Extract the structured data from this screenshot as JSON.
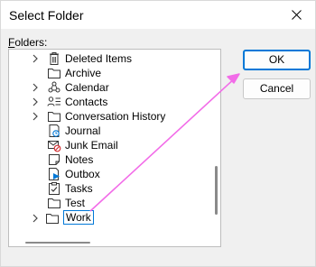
{
  "dialog": {
    "title": "Select Folder",
    "folders_label_accel": "F",
    "folders_label_rest": "olders:"
  },
  "tree": {
    "items": [
      {
        "label": "Deleted Items",
        "icon": "trash-icon",
        "has_chevron": true
      },
      {
        "label": "Archive",
        "icon": "folder-icon",
        "has_chevron": false
      },
      {
        "label": "Calendar",
        "icon": "calendar-icon",
        "has_chevron": true
      },
      {
        "label": "Contacts",
        "icon": "contacts-icon",
        "has_chevron": true
      },
      {
        "label": "Conversation History",
        "icon": "folder-icon",
        "has_chevron": true
      },
      {
        "label": "Journal",
        "icon": "journal-icon",
        "has_chevron": false
      },
      {
        "label": "Junk Email",
        "icon": "junk-email-icon",
        "has_chevron": false
      },
      {
        "label": "Notes",
        "icon": "notes-icon",
        "has_chevron": false
      },
      {
        "label": "Outbox",
        "icon": "outbox-icon",
        "has_chevron": false
      },
      {
        "label": "Tasks",
        "icon": "tasks-icon",
        "has_chevron": false
      },
      {
        "label": "Test",
        "icon": "folder-icon",
        "has_chevron": false
      },
      {
        "label": "Work",
        "icon": "folder-icon",
        "has_chevron": true,
        "selected": true
      }
    ]
  },
  "buttons": {
    "ok_label": "OK",
    "cancel_label": "Cancel"
  },
  "colors": {
    "accent": "#0078d7",
    "annotation_arrow": "#f26ce8"
  }
}
